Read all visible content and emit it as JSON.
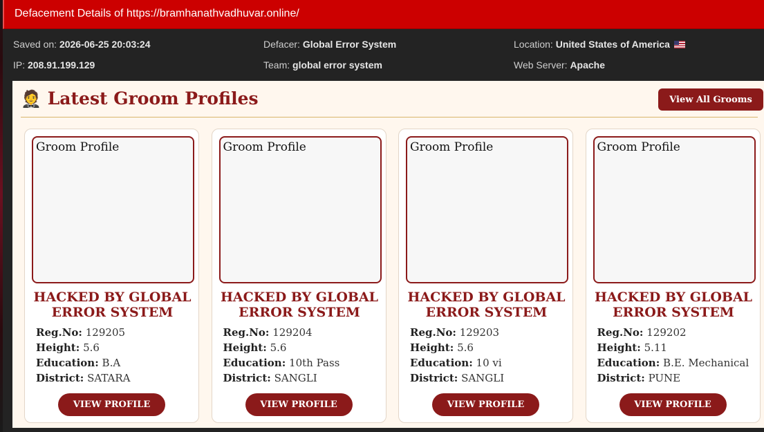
{
  "window": {
    "title": "Defacement Details of https://bramhanathvadhuvar.online/"
  },
  "meta": {
    "saved_label": "Saved on:",
    "saved_value": "2026-06-25 20:03:24",
    "defacer_label": "Defacer:",
    "defacer_value": "Global Error System",
    "location_label": "Location:",
    "location_value": "United States of America",
    "ip_label": "IP:",
    "ip_value": "208.91.199.129",
    "team_label": "Team:",
    "team_value": "global error system",
    "server_label": "Web Server:",
    "server_value": "Apache",
    "flag_icon": "us-flag-icon"
  },
  "section": {
    "icon": "🤵",
    "title": "Latest Groom Profiles",
    "view_all_label": "View All Grooms"
  },
  "labels": {
    "reg": "Reg.No:",
    "height": "Height:",
    "education": "Education:",
    "district": "District:"
  },
  "cards": [
    {
      "photo_alt": "Groom Profile",
      "name": "HACKED BY GLOBAL ERROR SYSTEM",
      "reg": "129205",
      "height": "5.6",
      "education": "B.A",
      "district": "SATARA",
      "button": "VIEW PROFILE"
    },
    {
      "photo_alt": "Groom Profile",
      "name": "HACKED BY GLOBAL ERROR SYSTEM",
      "reg": "129204",
      "height": "5.6",
      "education": "10th Pass",
      "district": "SANGLI",
      "button": "VIEW PROFILE"
    },
    {
      "photo_alt": "Groom Profile",
      "name": "HACKED BY GLOBAL ERROR SYSTEM",
      "reg": "129203",
      "height": "5.6",
      "education": "10 vi",
      "district": "SANGLI",
      "button": "VIEW PROFILE"
    },
    {
      "photo_alt": "Groom Profile",
      "name": "HACKED BY GLOBAL ERROR SYSTEM",
      "reg": "129202",
      "height": "5.11",
      "education": "B.E. Mechanical",
      "district": "PUNE",
      "button": "VIEW PROFILE"
    }
  ],
  "colors": {
    "title_bar": "#cc0000",
    "accent": "#8b1a1a",
    "content_bg": "#fff7ee"
  }
}
